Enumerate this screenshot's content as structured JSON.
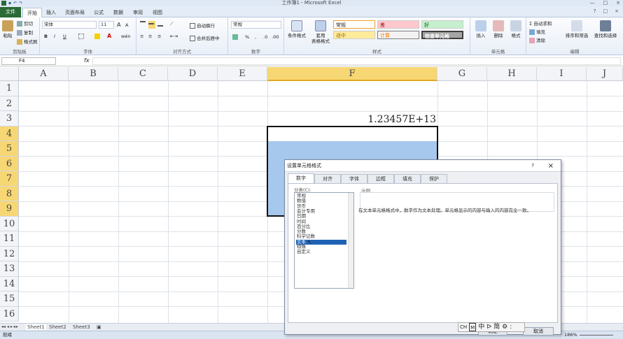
{
  "window": {
    "title": "工作簿1 - Microsoft Excel",
    "controls": [
      "—",
      "□",
      "×"
    ]
  },
  "tabs": [
    {
      "label": "文件"
    },
    {
      "label": "开始"
    },
    {
      "label": "插入"
    },
    {
      "label": "页面布局"
    },
    {
      "label": "公式"
    },
    {
      "label": "数据"
    },
    {
      "label": "审阅"
    },
    {
      "label": "视图"
    }
  ],
  "ribbon": {
    "clipboard": {
      "paste": "粘贴",
      "cut": "剪切",
      "copy": "复制",
      "format_painter": "格式刷",
      "label": "剪贴板"
    },
    "font": {
      "name": "宋体",
      "size": "11",
      "bold": "B",
      "italic": "I",
      "underline": "U",
      "grow": "A",
      "shrink": "A",
      "label": "字体",
      "size_chars": "wén"
    },
    "alignment": {
      "wrap": "自动换行",
      "merge": "合并后居中",
      "label": "对齐方式"
    },
    "number": {
      "format": "常规",
      "percent": "%",
      "comma": ",",
      "label": "数字"
    },
    "styles": {
      "conditional": "条件格式",
      "table": "套用\n表格格式",
      "normal": "常规",
      "bad": "差",
      "good": "好",
      "neutral": "适中",
      "calc": "计算",
      "check": "检查单元格",
      "label": "样式"
    },
    "cells": {
      "insert": "插入",
      "delete": "删除",
      "format": "格式",
      "label": "单元格"
    },
    "editing": {
      "autosum": "自动求和",
      "fill": "填充",
      "clear": "清除",
      "sort": "排序和筛选",
      "find": "查找和选择",
      "label": "编辑"
    }
  },
  "formula_bar": {
    "name_box": "F4",
    "fx": "fx",
    "value": ""
  },
  "grid": {
    "columns": [
      "A",
      "B",
      "C",
      "D",
      "E",
      "F",
      "G",
      "H",
      "I",
      "J"
    ],
    "rows": [
      "1",
      "2",
      "3",
      "4",
      "5",
      "6",
      "7",
      "8",
      "9",
      "10",
      "11",
      "12",
      "13",
      "14",
      "15",
      "16"
    ],
    "cell_f3": "1.23457E+13"
  },
  "sheets": [
    "Sheet1",
    "Sheet2",
    "Sheet3"
  ],
  "status": {
    "ready": "就绪",
    "zoom": "186%"
  },
  "dialog": {
    "title": "设置单元格格式",
    "help": "?",
    "close": "×",
    "tabs": [
      "数字",
      "对齐",
      "字体",
      "边框",
      "填充",
      "保护"
    ],
    "category_label": "分类(C):",
    "categories": [
      "常规",
      "数值",
      "货币",
      "会计专用",
      "日期",
      "时间",
      "百分比",
      "分数",
      "科学记数",
      "文本",
      "特殊",
      "自定义"
    ],
    "selected_category": "文本",
    "sample_label": "示例",
    "description": "在文本单元格格式中，数字作为文本处理。单元格显示的内容与输入的内容完全一致。",
    "ok": "确定",
    "cancel": "取消"
  },
  "ime": {
    "items": [
      "CH",
      "M",
      "中",
      "ᐅ",
      "简",
      "⚙",
      ":"
    ]
  }
}
